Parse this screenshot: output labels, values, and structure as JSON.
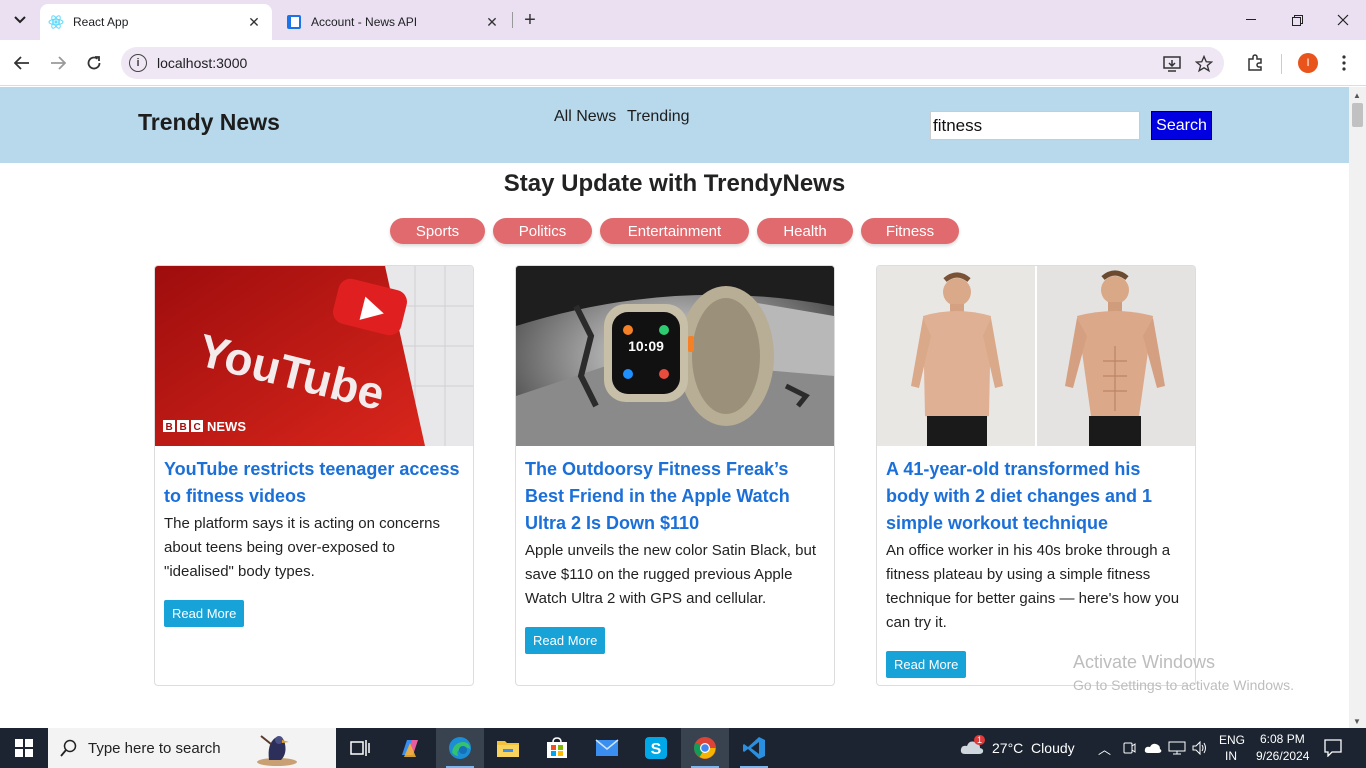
{
  "browser": {
    "tabs": [
      {
        "title": "React App",
        "active": true
      },
      {
        "title": "Account - News API",
        "active": false
      }
    ],
    "url": "localhost:3000",
    "profile_initial": "I"
  },
  "site": {
    "brand": "Trendy News",
    "nav_links": [
      "All News",
      "Trending"
    ],
    "search_value": "fitness",
    "search_button": "Search",
    "heading": "Stay Update with TrendyNews",
    "categories": [
      "Sports",
      "Politics",
      "Entertainment",
      "Health",
      "Fitness"
    ],
    "cards": [
      {
        "title": "YouTube restricts teenager access to fitness videos",
        "description": "The platform says it is acting on concerns about teens being over-exposed to \"idealised\" body types.",
        "button": "Read More",
        "image_text": "YouTube",
        "image_badge": "BBC NEWS"
      },
      {
        "title": "The Outdoorsy Fitness Freak’s Best Friend in the Apple Watch Ultra 2 Is Down $110",
        "description": "Apple unveils the new color Satin Black, but save $110 on the rugged previous Apple Watch Ultra 2 with GPS and cellular.",
        "button": "Read More",
        "image_time": "10:09"
      },
      {
        "title": "A 41-year-old transformed his body with 2 diet changes and 1 simple workout technique",
        "description": "An office worker in his 40s broke through a fitness plateau by using a simple fitness technique for better gains — here's how you can try it.",
        "button": "Read More"
      }
    ]
  },
  "watermark": {
    "line1": "Activate Windows",
    "line2": "Go to Settings to activate Windows."
  },
  "taskbar": {
    "search_placeholder": "Type here to search",
    "weather": "27°C  Cloudy",
    "weather_badge": "1",
    "language": "ENG",
    "region": "IN",
    "time": "6:08 PM",
    "date": "9/26/2024"
  },
  "colors": {
    "nav_bg": "#b8d9ec",
    "category_pill": "#e06a6e",
    "card_title": "#1a6fd8",
    "read_more": "#17a2d8",
    "search_button": "#0000e0"
  }
}
